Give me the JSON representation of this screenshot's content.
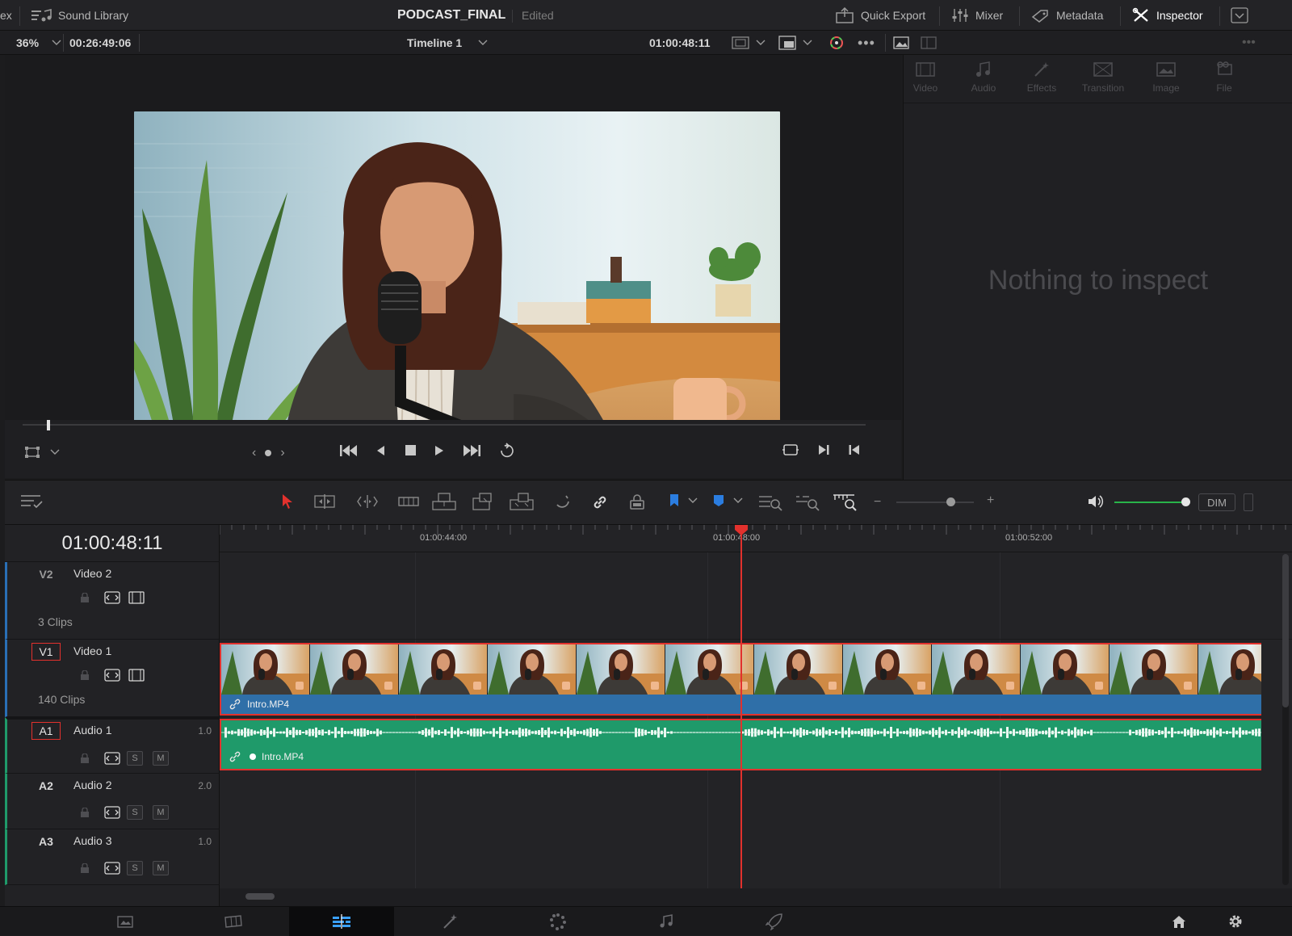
{
  "topbar": {
    "left_cut": "ex",
    "sound_library": "Sound Library",
    "project_title": "PODCAST_FINAL",
    "project_status": "Edited",
    "quick_export": "Quick Export",
    "mixer": "Mixer",
    "metadata": "Metadata",
    "inspector": "Inspector"
  },
  "viewer": {
    "zoom": "36%",
    "source_duration": "00:26:49:06",
    "timeline_name": "Timeline 1",
    "timecode": "01:00:48:11"
  },
  "inspector_panel": {
    "tabs": [
      "Video",
      "Audio",
      "Effects",
      "Transition",
      "Image",
      "File"
    ],
    "empty_message": "Nothing to inspect"
  },
  "toolbar": {
    "dim_label": "DIM"
  },
  "timeline": {
    "current_timecode": "01:00:48:11",
    "ruler_labels": [
      "01:00:44:00",
      "01:00:48:00",
      "01:00:52:00"
    ],
    "tracks": [
      {
        "code": "V2",
        "name": "Video 2",
        "clips": "3 Clips"
      },
      {
        "code": "V1",
        "name": "Video 1",
        "clips": "140 Clips"
      },
      {
        "code": "A1",
        "name": "Audio 1",
        "volume": "1.0"
      },
      {
        "code": "A2",
        "name": "Audio 2",
        "volume": "2.0"
      },
      {
        "code": "A3",
        "name": "Audio 3",
        "volume": "1.0"
      }
    ],
    "video_clip_name": "Intro.MP4",
    "audio_clip_name": "Intro.MP4",
    "solo_label": "S",
    "mute_label": "M"
  },
  "colors": {
    "accent_red": "#e2312d",
    "video_clip": "#2f6fa8",
    "audio_clip": "#1f9a6a",
    "inspector_active": "#ffffff"
  }
}
